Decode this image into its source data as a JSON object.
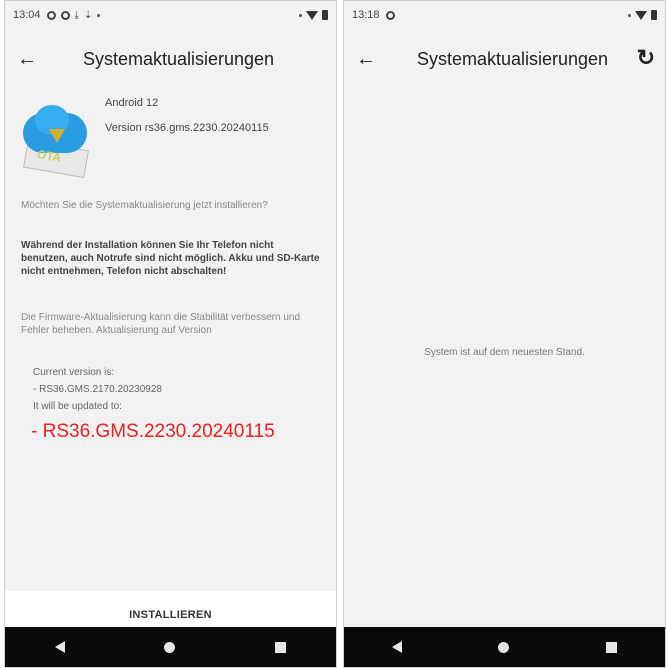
{
  "left": {
    "status": {
      "time": "13:04"
    },
    "appbar": {
      "back": "←",
      "title": "Systemaktualisierungen"
    },
    "update": {
      "android": "Android 12",
      "version": "Version rs36.gms.2230.20240115",
      "icon_label": "OTA"
    },
    "question": "Möchten Sie die Systemaktualisierung jetzt installieren?",
    "warning": "Während der Installation können Sie Ihr Telefon nicht benutzen, auch Notrufe sind nicht möglich. Akku und SD-Karte nicht entnehmen, Telefon nicht abschalten!",
    "description": "Die Firmware-Aktualisierung kann die Stabilität verbessern und Fehler beheben. Aktualisierung auf Version",
    "current_label": "Current version is:",
    "current_version": "- RS36.GMS.2170.20230928",
    "updated_label": "It will be updated to:",
    "new_version": "- RS36.GMS.2230.20240115",
    "install_button": "INSTALLIEREN"
  },
  "right": {
    "status": {
      "time": "13:18"
    },
    "appbar": {
      "back": "←",
      "title": "Systemaktualisierungen",
      "refresh": "↻"
    },
    "message": "System ist auf dem neuesten Stand."
  },
  "colors": {
    "accent_red": "#e82020",
    "navbar": "#0a0a0a",
    "background": "#f2f2f2"
  }
}
